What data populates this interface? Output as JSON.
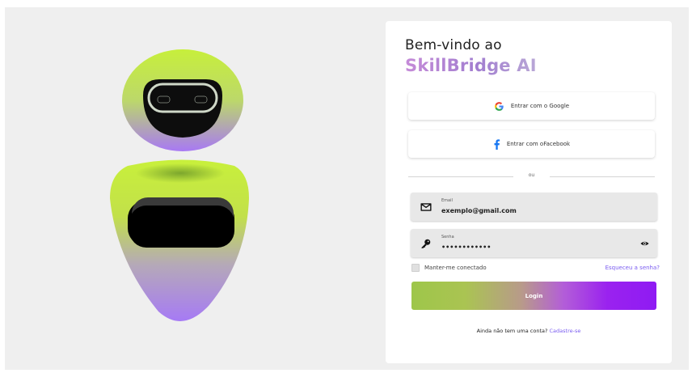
{
  "welcome_text": "Bem-vindo ao",
  "brand_name": "SkillBridge AI",
  "social": {
    "google_label": "Entrar com o Google",
    "google_icon": "google-icon",
    "facebook_label": "Entrar com oFacebook",
    "facebook_icon": "facebook-icon"
  },
  "divider_text": "ou",
  "email": {
    "label": "Email",
    "value": "exemplo@gmail.com",
    "icon": "mail-icon"
  },
  "password": {
    "label": "Senha",
    "value": "••••••••••••",
    "icon": "key-icon",
    "toggle_icon": "eye-icon"
  },
  "remember_label": "Manter-me conectado",
  "forgot_label": "Esqueceu a senha?",
  "login_label": "Login",
  "signup_prompt": "Ainda não tem uma conta?",
  "signup_link": "Cadastre-se",
  "colors": {
    "accent": "#7a5cf0",
    "lime": "#c6ef3a",
    "purple": "#a77af4",
    "button_end": "#8f1bf3"
  }
}
